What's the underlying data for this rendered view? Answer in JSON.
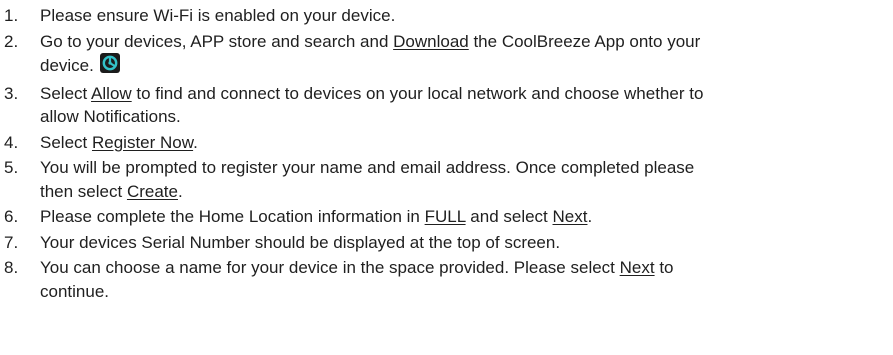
{
  "steps": [
    {
      "number": "1.",
      "lines": [
        [
          "Please ensure Wi-Fi is enabled on your device."
        ]
      ]
    },
    {
      "number": "2.",
      "lines": [
        [
          "Go to your devices, APP store and search and ",
          {
            "link": "Download"
          },
          " the CoolBreeze App  onto your"
        ],
        [
          "device."
        ]
      ],
      "icon": "coolbreeze-app-icon"
    },
    {
      "number": "3.",
      "lines": [
        [
          "Select ",
          {
            "link": "Allow"
          },
          " to find and connect to devices on your local network and choose whether to"
        ],
        [
          "allow Notifications."
        ]
      ]
    },
    {
      "number": "4.",
      "lines": [
        [
          "Select ",
          {
            "link": "Register Now"
          },
          "."
        ]
      ]
    },
    {
      "number": "5.",
      "lines": [
        [
          "You will be prompted to register your name and email address. Once completed please"
        ],
        [
          "then select ",
          {
            "link": "Create"
          },
          "."
        ]
      ]
    },
    {
      "number": "6.",
      "lines": [
        [
          "Please complete the Home Location information in ",
          {
            "link": "FULL"
          },
          " and select ",
          {
            "link": "Next"
          },
          "."
        ]
      ]
    },
    {
      "number": "7.",
      "lines": [
        [
          "Your devices Serial Number should be displayed at the top of screen."
        ]
      ]
    },
    {
      "number": "8.",
      "lines": [
        [
          "You can choose a name for your device in the space provided. Please select ",
          {
            "link": "Next"
          },
          " to"
        ],
        [
          "continue."
        ]
      ]
    }
  ],
  "colors": {
    "text": "#1f1f1f",
    "icon_background": "#1b1b1b",
    "icon_accent": "#33c2c9"
  }
}
